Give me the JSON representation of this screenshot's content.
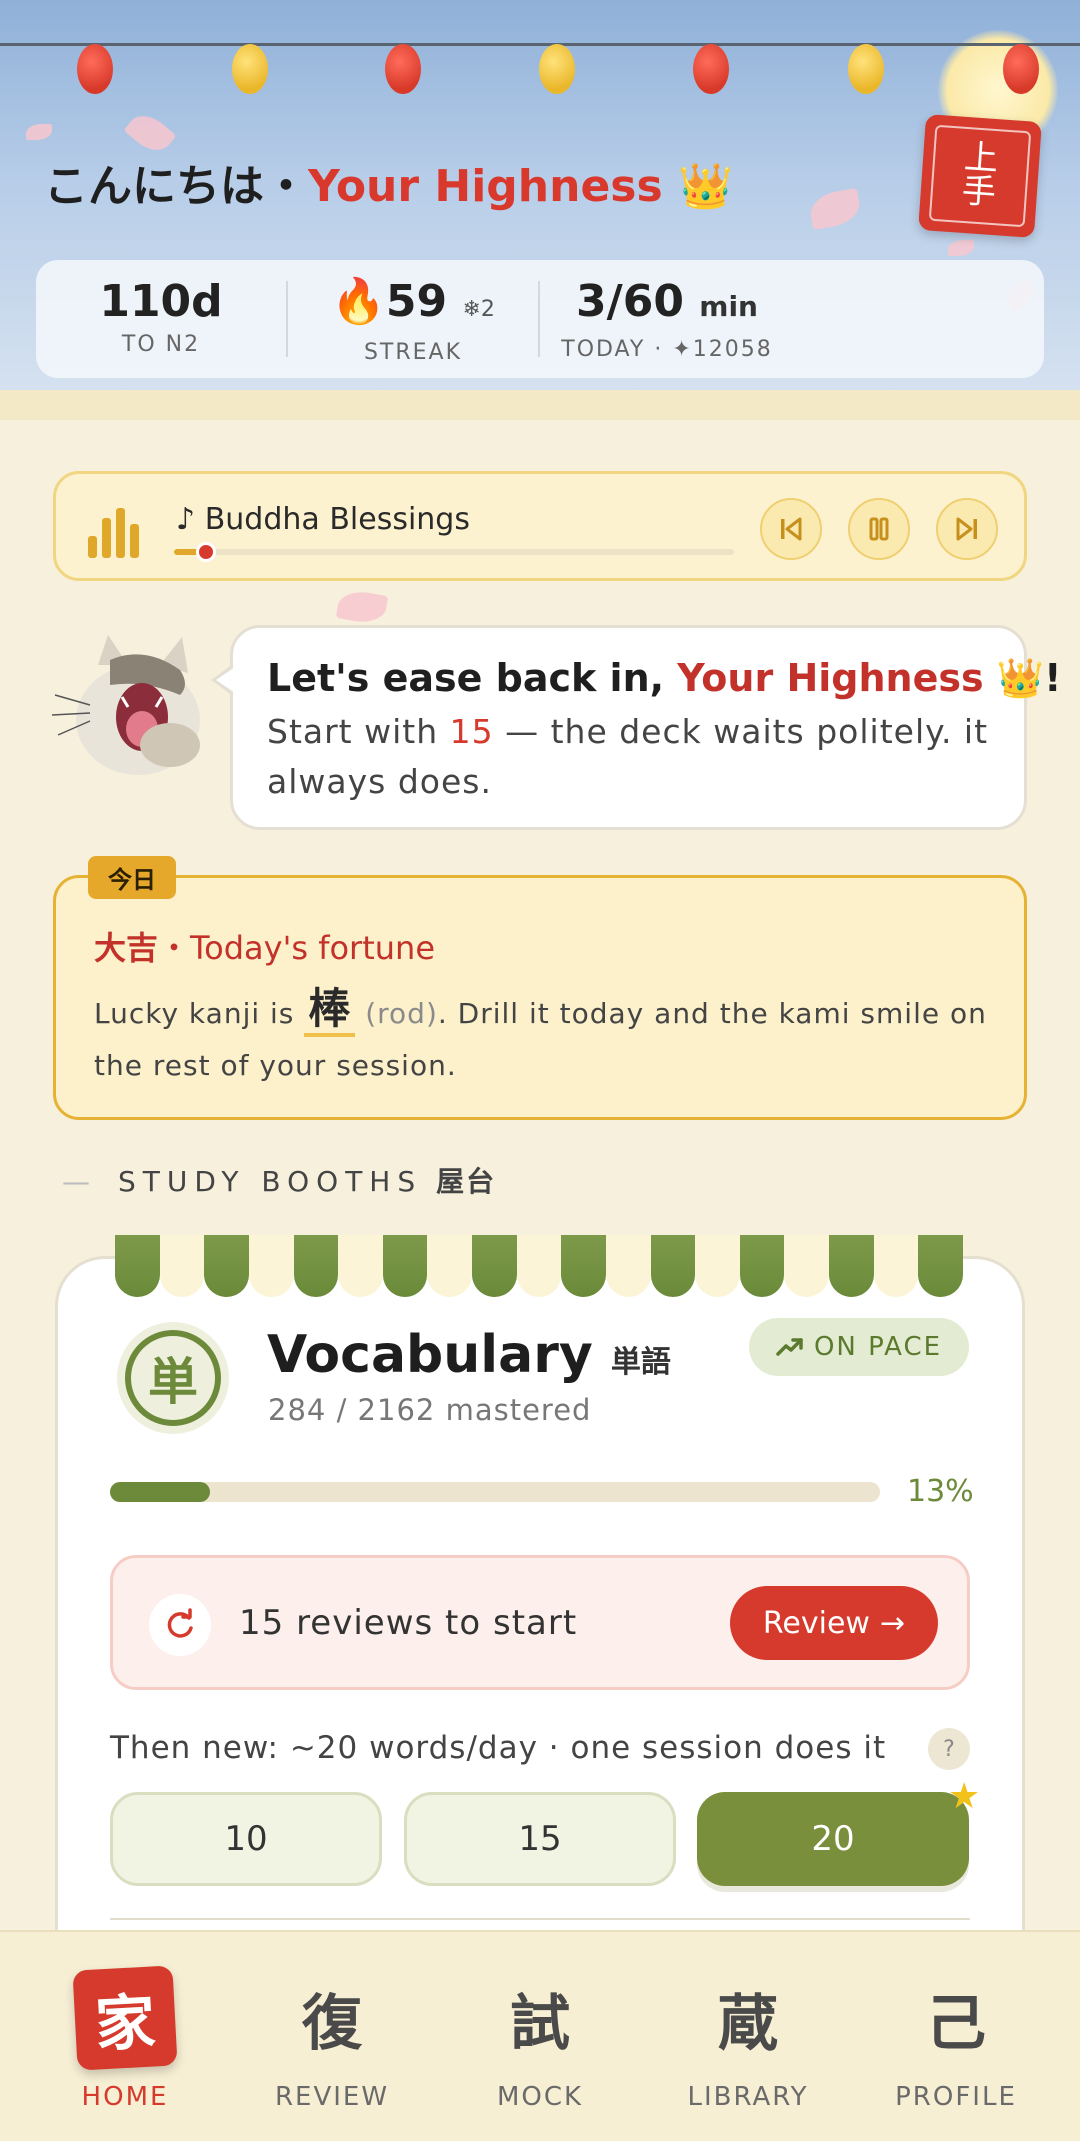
{
  "header": {
    "greeting_prefix": "こんにちは・",
    "greeting_name": "Your Highness",
    "greeting_emoji": "👑",
    "hanko_top": "上",
    "hanko_bottom": "手"
  },
  "stats": {
    "countdown_value": "110d",
    "countdown_label": "TO N2",
    "streak_value": "59",
    "streak_freeze": "❄2",
    "streak_label": "STREAK",
    "today_value": "3/60",
    "today_unit": "min",
    "today_label": "TODAY · ✦12058"
  },
  "player": {
    "track_note": "♪",
    "track_title": "Buddha Blessings",
    "progress": 0.04
  },
  "mascot": {
    "line1_prefix": "Let's ease back in, ",
    "line1_name": "Your Highness",
    "line1_suffix": " 👑!",
    "line2_prefix": "Start with ",
    "line2_count": "15",
    "line2_suffix": " — the deck waits politely. it always does."
  },
  "fortune": {
    "tag": "今日",
    "title_bold": "大吉",
    "title_rest": "・Today's fortune",
    "body_prefix": "Lucky kanji is ",
    "kanji": "棒",
    "kanji_meaning": "(rod)",
    "body_suffix": ". Drill it today and the kami smile on the rest of your session."
  },
  "section": {
    "dash": "—",
    "title": "STUDY BOOTHS",
    "title_jp": "屋台"
  },
  "booth": {
    "icon_char": "単",
    "title": "Vocabulary",
    "title_jp": "単語",
    "mastered": "284 / 2162 mastered",
    "pace_label": "ON PACE",
    "progress_pct_label": "13%",
    "progress": 0.13,
    "reviews_text": "15 reviews to start",
    "review_button": "Review",
    "then_new": "Then new: ~20 words/day · one session does it",
    "help": "?",
    "choices": [
      "10",
      "15",
      "20"
    ],
    "selected_choice": "20"
  },
  "tabs": [
    {
      "glyph": "家",
      "label": "HOME",
      "active": true
    },
    {
      "glyph": "復",
      "label": "REVIEW",
      "active": false
    },
    {
      "glyph": "試",
      "label": "MOCK",
      "active": false
    },
    {
      "glyph": "蔵",
      "label": "LIBRARY",
      "active": false
    },
    {
      "glyph": "己",
      "label": "PROFILE",
      "active": false
    }
  ],
  "colors": {
    "accent_red": "#d63a2c",
    "accent_green": "#6d8a3b",
    "accent_gold": "#e0a82a"
  }
}
